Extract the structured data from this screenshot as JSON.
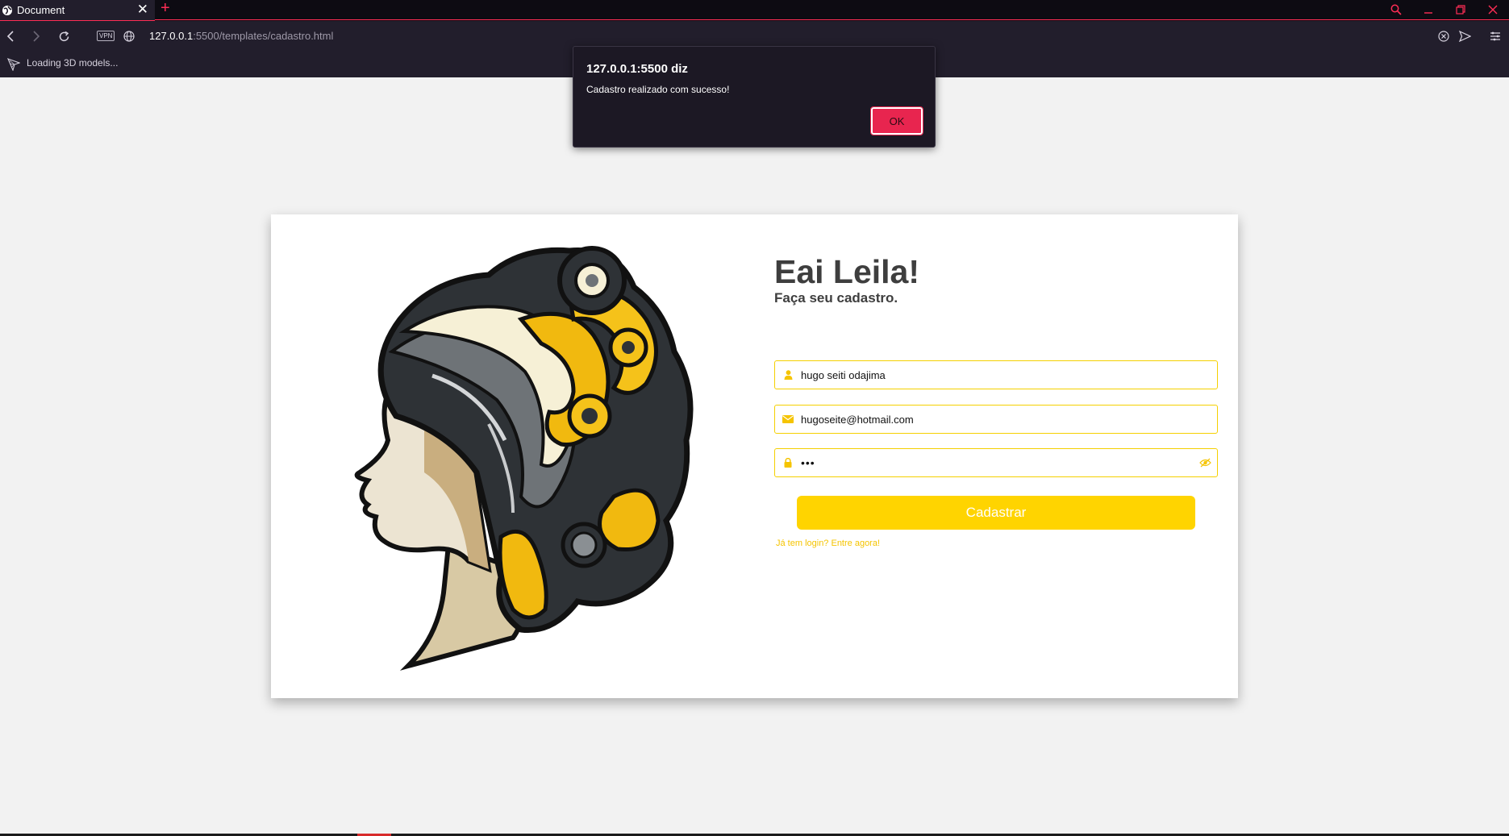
{
  "browser": {
    "tab_title": "Document",
    "tab_close": "✕",
    "new_tab": "+",
    "url_host": "127.0.0.1",
    "url_path": ":5500/templates/cadastro.html",
    "vpn_badge": "VPN",
    "status_text": "Loading 3D models..."
  },
  "dialog": {
    "title": "127.0.0.1:5500 diz",
    "message": "Cadastro realizado com sucesso!",
    "ok_label": "OK"
  },
  "page": {
    "greeting": "Eai Leila!",
    "subtitle": "Faça seu cadastro.",
    "name_value": "hugo seiti odajima",
    "email_value": "hugoseite@hotmail.com",
    "password_value": "•••",
    "submit_label": "Cadastrar",
    "login_link": "Já tem login? Entre agora!"
  },
  "colors": {
    "accent_yellow": "#ffd400",
    "browser_accent": "#ff2d55",
    "chrome_bg": "#221e2c",
    "page_bg": "#f2f2f2"
  }
}
